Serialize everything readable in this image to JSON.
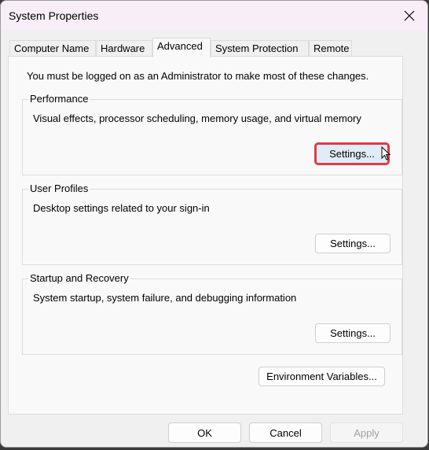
{
  "window": {
    "title": "System Properties"
  },
  "tabs": [
    {
      "label": "Computer Name",
      "active": false
    },
    {
      "label": "Hardware",
      "active": false
    },
    {
      "label": "Advanced",
      "active": true
    },
    {
      "label": "System Protection",
      "active": false
    },
    {
      "label": "Remote",
      "active": false
    }
  ],
  "panel": {
    "admin_note": "You must be logged on as an Administrator to make most of these changes.",
    "groups": [
      {
        "label": "Performance",
        "description": "Visual effects, processor scheduling, memory usage, and virtual memory",
        "button": "Settings...",
        "highlighted": true
      },
      {
        "label": "User Profiles",
        "description": "Desktop settings related to your sign-in",
        "button": "Settings..."
      },
      {
        "label": "Startup and Recovery",
        "description": "System startup, system failure, and debugging information",
        "button": "Settings..."
      }
    ],
    "env_button": "Environment Variables..."
  },
  "footer": {
    "ok": "OK",
    "cancel": "Cancel",
    "apply": "Apply",
    "apply_disabled": true
  },
  "colors": {
    "highlight_border": "#e03c44",
    "titlebar_bg": "#f7eef7"
  },
  "icons": {
    "close": "close-icon",
    "cursor": "mouse-pointer-icon"
  }
}
